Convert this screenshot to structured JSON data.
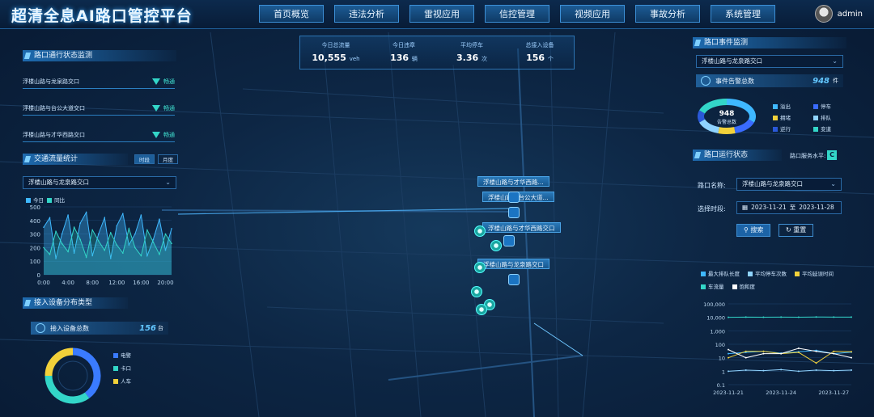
{
  "header": {
    "title": "超清全息AI路口管控平台",
    "nav": [
      "首页概览",
      "违法分析",
      "雷视应用",
      "信控管理",
      "视频应用",
      "事故分析",
      "系统管理"
    ],
    "user": "admin"
  },
  "colors": {
    "accent": "#3fb8ff",
    "teal": "#33d6c8",
    "yellow": "#f2d13a",
    "bg": "#07172e"
  },
  "left": {
    "status_panel": {
      "title": "路口通行状态监测",
      "rows": [
        {
          "name": "浮楼山路与龙泉路交口",
          "status": "畅通"
        },
        {
          "name": "浮楼山路与台公大道交口",
          "status": "畅通"
        },
        {
          "name": "浮楼山路与才华西路交口",
          "status": "畅通"
        }
      ]
    },
    "traffic_panel": {
      "title": "交通流量统计",
      "toggle": [
        "时段",
        "月度"
      ],
      "selected": "浮楼山路与龙泉路交口",
      "legend": [
        "今日",
        "同比"
      ]
    },
    "device_panel": {
      "title": "接入设备分布类型",
      "total_label": "接入设备总数",
      "total_value": "156",
      "total_unit": "台",
      "legend": [
        "电警",
        "卡口",
        "人车"
      ]
    }
  },
  "center": {
    "kpis": [
      {
        "label": "今日总流量",
        "value": "10,555",
        "unit": "veh"
      },
      {
        "label": "今日违章",
        "value": "136",
        "unit": "辆"
      },
      {
        "label": "平均停车",
        "value": "3.36",
        "unit": "次"
      },
      {
        "label": "总接入设备",
        "value": "156",
        "unit": "个"
      }
    ],
    "map_labels": [
      "浮楼山路与才华西路...",
      "浮楼山路与台公大道...",
      "浮楼山路与才华西路交口",
      "浮楼山路与龙泉路交口"
    ]
  },
  "right": {
    "event_panel": {
      "title": "路口事件监测",
      "selected": "浮楼山路与龙泉路交口",
      "total_label": "事件告警总数",
      "total_value": "948",
      "total_unit": "件",
      "donut_value": "948",
      "donut_label": "告警总数",
      "legend": [
        "溢出",
        "停车",
        "拥堵",
        "排队",
        "逆行",
        "变道"
      ]
    },
    "run_panel": {
      "title": "路口运行状态",
      "service_label": "路口服务水平:",
      "service_value": "C",
      "intersection_label": "路口名称:",
      "intersection_value": "浮楼山路与龙泉路交口",
      "period_label": "选择时段:",
      "date_from": "2023-11-21",
      "date_to_sep": "至",
      "date_to": "2023-11-28",
      "search_btn": "搜索",
      "reset_btn": "重置",
      "legend": [
        "最大排队长度",
        "平均停车次数",
        "平均延误时间",
        "车流量",
        "饱和度"
      ]
    }
  },
  "chart_data": [
    {
      "type": "area",
      "x": [
        "0:00",
        "1:00",
        "2:00",
        "3:00",
        "4:00",
        "5:00",
        "6:00",
        "7:00",
        "8:00",
        "9:00",
        "10:00",
        "11:00",
        "12:00",
        "13:00",
        "14:00",
        "15:00",
        "16:00",
        "17:00",
        "18:00",
        "19:00",
        "20:00",
        "21:00"
      ],
      "series": [
        {
          "name": "今日",
          "values": [
            350,
            420,
            120,
            300,
            440,
            160,
            380,
            460,
            140,
            300,
            420,
            120,
            360,
            450,
            220,
            300,
            440,
            140,
            260,
            410,
            180,
            340
          ]
        },
        {
          "name": "同比",
          "values": [
            200,
            150,
            320,
            230,
            170,
            350,
            260,
            130,
            330,
            250,
            180,
            310,
            220,
            160,
            340,
            200,
            140,
            330,
            240,
            150,
            300,
            230
          ]
        }
      ],
      "ylim": [
        0,
        500
      ],
      "yticks": [
        0,
        100,
        200,
        300,
        400,
        500
      ],
      "xticks": [
        "0:00",
        "4:00",
        "8:00",
        "12:00",
        "16:00",
        "20:00"
      ]
    },
    {
      "type": "pie",
      "categories": [
        "电警",
        "卡口",
        "人车"
      ],
      "values": [
        40,
        35,
        25
      ]
    },
    {
      "type": "line",
      "x": [
        "2023-11-21",
        "2023-11-22",
        "2023-11-23",
        "2023-11-24",
        "2023-11-25",
        "2023-11-26",
        "2023-11-27",
        "2023-11-28"
      ],
      "xticks": [
        "2023-11-21",
        "2023-11-24",
        "2023-11-27"
      ],
      "yscale": "log",
      "yticks": [
        "0.1",
        "1",
        "10",
        "100",
        "1,000",
        "10,000",
        "100,000"
      ],
      "series": [
        {
          "name": "最大排队长度",
          "values": [
            20,
            25,
            30,
            22,
            28,
            35,
            20,
            26
          ]
        },
        {
          "name": "平均停车次数",
          "values": [
            1,
            1.2,
            1.1,
            1.3,
            1.0,
            1.2,
            1.1,
            1.2
          ]
        },
        {
          "name": "平均延误时间",
          "values": [
            10,
            30,
            30,
            20,
            25,
            4,
            30,
            28
          ]
        },
        {
          "name": "车流量",
          "values": [
            10000,
            10500,
            10200,
            10400,
            10300,
            10600,
            10500,
            10400
          ]
        },
        {
          "name": "饱和度",
          "values": [
            40,
            10,
            20,
            20,
            50,
            30,
            20,
            10
          ]
        }
      ]
    }
  ]
}
